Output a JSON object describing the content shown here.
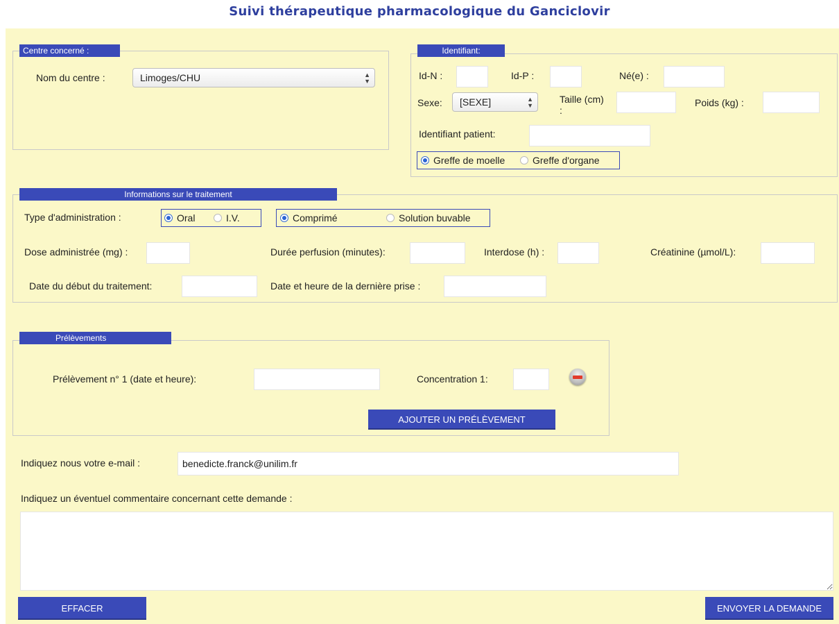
{
  "title": "Suivi thérapeutique pharmacologique du Ganciclovir",
  "centre": {
    "legend": "Centre concerné :",
    "label": "Nom du centre :",
    "value": "Limoges/CHU"
  },
  "identifiant": {
    "legend": "Identifiant:",
    "idn_label": "Id-N :",
    "idp_label": "Id-P :",
    "ne_label": "Né(e) :",
    "sexe_label": "Sexe:",
    "sexe_value": "[SEXE]",
    "taille_label": "Taille (cm)",
    "taille_colon": ":",
    "poids_label": "Poids (kg) :",
    "patient_label": "Identifiant patient:",
    "greffe_moelle": "Greffe de moelle",
    "greffe_organe": "Greffe d'organe"
  },
  "traitement": {
    "legend": "Informations sur le traitement",
    "type_label": "Type d'administration :",
    "oral": "Oral",
    "iv": "I.V.",
    "comprime": "Comprimé",
    "solution": "Solution buvable",
    "dose_label": "Dose administrée  (mg) :",
    "duree_label": "Durée perfusion (minutes):",
    "interdose_label": "Interdose (h) :",
    "creat_label": "Créatinine (µmol/L):",
    "debut_label": "Date du début du traitement:",
    "derniere_label": "Date et heure de la dernière prise :"
  },
  "prelevements": {
    "legend": "Prélèvements",
    "row_label": "Prélèvement n° 1 (date et heure):",
    "conc_label": "Concentration 1:",
    "add_button": "AJOUTER UN PRÉLÈVEMENT"
  },
  "email": {
    "label": "Indiquez nous votre e-mail :",
    "value": "benedicte.franck@unilim.fr"
  },
  "comment": {
    "label": "Indiquez un éventuel commentaire concernant cette demande :"
  },
  "buttons": {
    "clear": "EFFACER",
    "submit": "ENVOYER LA DEMANDE"
  },
  "colors": {
    "accent": "#3a4ab8",
    "background": "#fbf8c8",
    "title": "#2e3f9e"
  }
}
